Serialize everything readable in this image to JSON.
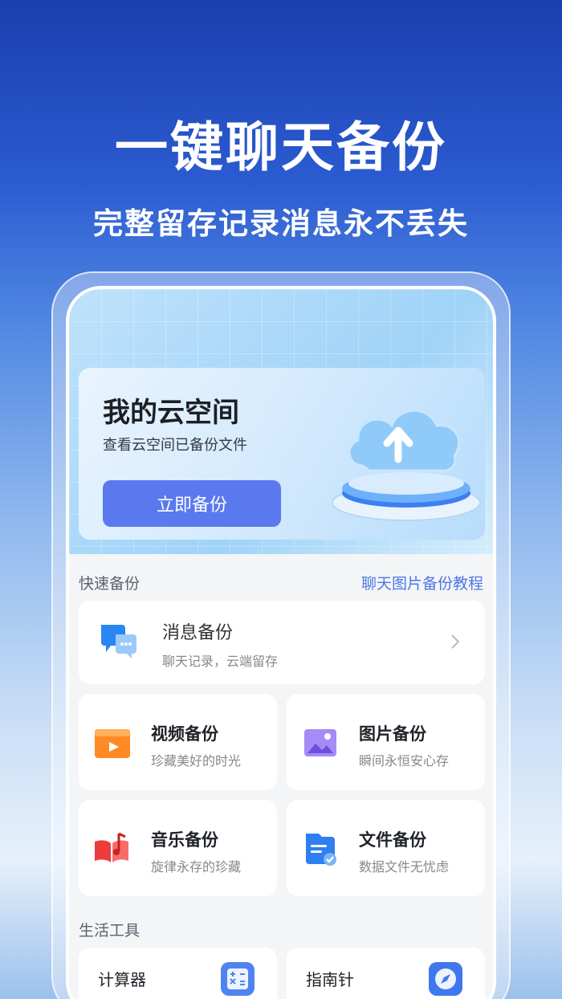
{
  "hero": {
    "title": "一键聊天备份",
    "subtitle": "完整留存记录消息永不丢失"
  },
  "banner": {
    "title": "我的云空间",
    "subtitle": "查看云空间已备份文件",
    "button_label": "立即备份",
    "art_icon": "cloud-upload-icon"
  },
  "quick_backup": {
    "section_label": "快速备份",
    "tutorial_link": "聊天图片备份教程",
    "message_card": {
      "title": "消息备份",
      "subtitle": "聊天记录，云端留存",
      "icon": "chat-bubble-icon"
    },
    "items": [
      {
        "title": "视频备份",
        "subtitle": "珍藏美好的时光",
        "icon": "video-icon",
        "color": "#ff8a25"
      },
      {
        "title": "图片备份",
        "subtitle": "瞬间永恒安心存",
        "icon": "image-icon",
        "color": "#8c6cf0"
      },
      {
        "title": "音乐备份",
        "subtitle": "旋律永存的珍藏",
        "icon": "music-icon",
        "color": "#ee3b3b"
      },
      {
        "title": "文件备份",
        "subtitle": "数据文件无忧虑",
        "icon": "file-icon",
        "color": "#2f7ff0"
      }
    ]
  },
  "life_tools": {
    "section_label": "生活工具",
    "items": [
      {
        "title": "计算器",
        "icon": "calculator-icon"
      },
      {
        "title": "指南针",
        "icon": "compass-icon"
      }
    ]
  },
  "colors": {
    "accent": "#5a79ee",
    "link": "#4e76e6"
  }
}
